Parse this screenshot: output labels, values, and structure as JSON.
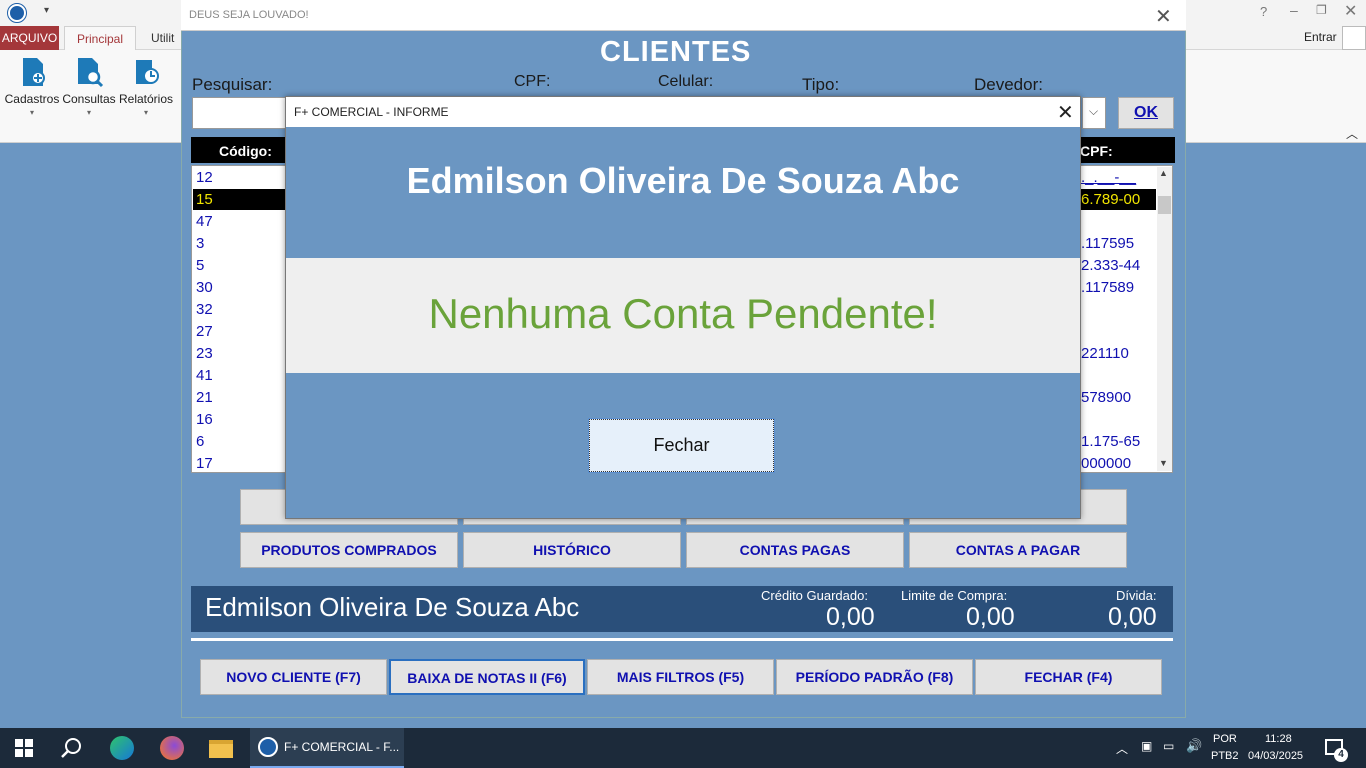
{
  "access": {
    "tabs": {
      "arquivo": "ARQUIVO",
      "principal": "Principal",
      "utilitarios": "Utilit"
    },
    "ribbon_buttons": [
      "Cadastros",
      "Consultas",
      "Relatórios"
    ],
    "entrar": "Entrar",
    "help": "?"
  },
  "form": {
    "window_title": "DEUS SEJA LOUVADO!",
    "heading": "CLIENTES",
    "labels": {
      "pesquisar": "Pesquisar:",
      "cpf": "CPF:",
      "celular": "Celular:",
      "tipo": "Tipo:",
      "devedor": "Devedor:"
    },
    "ok_button": "OK",
    "grid": {
      "col_codigo": "Código:",
      "col_cpf": "CPF:",
      "codes": [
        "12",
        "15",
        "47",
        "3",
        "5",
        "30",
        "32",
        "27",
        "23",
        "41",
        "21",
        "16",
        "6",
        "17"
      ],
      "cpfs": [
        "._.__-__",
        "6.789-00",
        "",
        ".117595",
        "2.333-44",
        ".117589",
        "",
        "",
        "221110",
        "",
        "578900",
        "",
        "1.175-65",
        "000000"
      ],
      "selected_index": 1
    },
    "buttons_row2": [
      "PRODUTOS COMPRADOS",
      "HISTÓRICO",
      "CONTAS PAGAS",
      "CONTAS A PAGAR"
    ],
    "client_name": "Edmilson Oliveira De Souza Abc",
    "credito_label": "Crédito Guardado:",
    "credito_value": "0,00",
    "limite_label": "Limite de Compra:",
    "limite_value": "0,00",
    "divida_label": "Dívida:",
    "divida_value": "0,00",
    "bottom_buttons": [
      "NOVO CLIENTE  (F7)",
      "BAIXA DE NOTAS II  (F6)",
      "MAIS FILTROS (F5)",
      "PERÍODO PADRÃO (F8)",
      "FECHAR (F4)"
    ]
  },
  "modal": {
    "title": "F+ COMERCIAL - INFORME",
    "client_name": "Edmilson Oliveira De Souza Abc",
    "message": "Nenhuma Conta Pendente!",
    "close_button": "Fechar"
  },
  "taskbar": {
    "active_app": "F+ COMERCIAL - F...",
    "lang": "POR",
    "lang2": "PTB2",
    "time": "11:28",
    "date": "04/03/2025",
    "notifications": "4"
  }
}
